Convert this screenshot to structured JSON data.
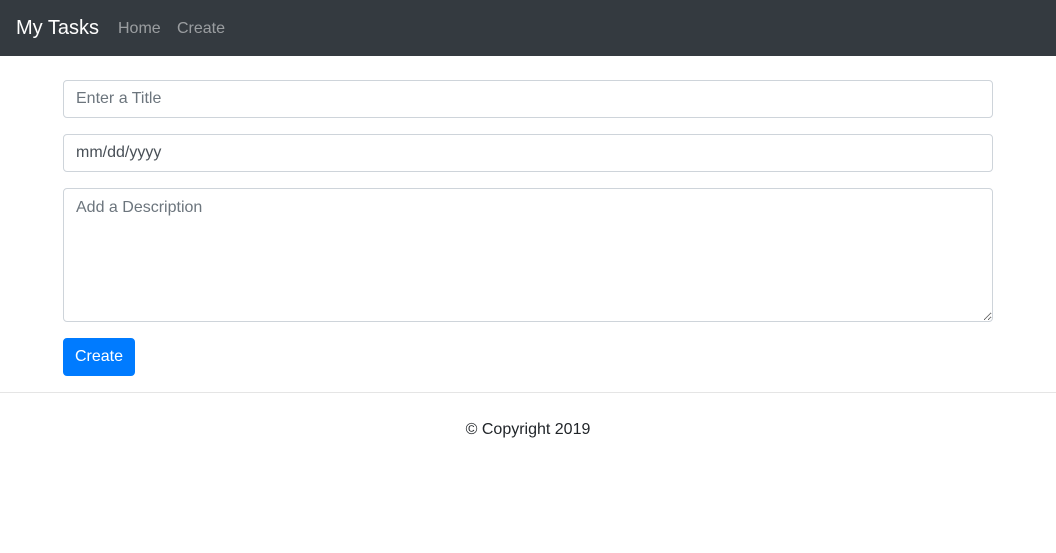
{
  "navbar": {
    "brand": "My Tasks",
    "links": [
      {
        "label": "Home"
      },
      {
        "label": "Create"
      }
    ],
    "background": "#343a40"
  },
  "form": {
    "title_placeholder": "Enter a Title",
    "date_placeholder": "mm/dd/yyyy",
    "description_placeholder": "Add a Description",
    "submit_label": "Create",
    "submit_color": "#007bff"
  },
  "footer": {
    "text": "© Copyright 2019"
  }
}
